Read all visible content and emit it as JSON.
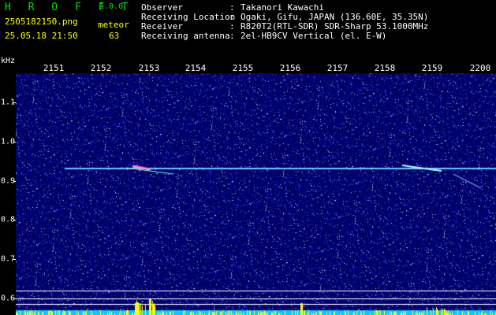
{
  "header": {
    "app_logo": "H R O F F T",
    "version": "1.0.0",
    "filename": "2505182150.png",
    "category": "meteor",
    "datetime": "25.05.18 21:50",
    "count": "63",
    "info": [
      {
        "key": "Observer",
        "sep": ":",
        "value": "Takanori Kawachi"
      },
      {
        "key": "Receiving Location",
        "sep": ":",
        "value": "Ogaki, Gifu, JAPAN (136.60E, 35.35N)"
      },
      {
        "key": "Receiver",
        "sep": ":",
        "value": "R820T2(RTL-SDR) SDR-Sharp 53.1000MHz"
      },
      {
        "key": "Receiving antenna",
        "sep": ":",
        "value": "2el-HB9CV Vertical (el. E-W)"
      }
    ]
  },
  "axes": {
    "unit": "kHz",
    "time_labels": [
      "2151",
      "2152",
      "2153",
      "2154",
      "2155",
      "2156",
      "2157",
      "2158",
      "2159",
      "2200"
    ],
    "freq_labels": [
      "1.1",
      "1.0",
      "0.9",
      "0.8",
      "0.7",
      "0.6"
    ]
  },
  "colors": {
    "background": "#000000",
    "noise_base": "#000066",
    "carrier": "#66ccff",
    "logo": "#00e000",
    "meta": "#ffff00",
    "text": "#ffffff",
    "power_bar": "#ffff00",
    "power_base": "#00ccff"
  }
}
